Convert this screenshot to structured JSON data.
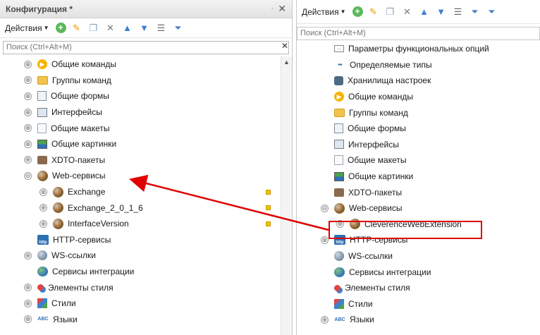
{
  "left": {
    "title": "Конфигурация *",
    "toolbar": {
      "actions_label": "Действия"
    },
    "search": {
      "placeholder": "Поиск (Ctrl+Alt+M)"
    },
    "items": [
      {
        "label": "Общие команды",
        "icon": "command-icon",
        "expander": "⊕"
      },
      {
        "label": "Группы команд",
        "icon": "folder-icon",
        "expander": "⊕"
      },
      {
        "label": "Общие формы",
        "icon": "form-icon",
        "expander": "⊕"
      },
      {
        "label": "Интерфейсы",
        "icon": "interface-icon",
        "expander": "⊕"
      },
      {
        "label": "Общие макеты",
        "icon": "layout-icon",
        "expander": "⊕"
      },
      {
        "label": "Общие картинки",
        "icon": "picture-icon",
        "expander": "⊕"
      },
      {
        "label": "XDTO-пакеты",
        "icon": "xdto-icon",
        "expander": "⊕"
      },
      {
        "label": "Web-сервисы",
        "icon": "web-service-icon",
        "expander": "⊖"
      },
      {
        "label": "Exchange",
        "icon": "web-service-icon",
        "expander": "⊕"
      },
      {
        "label": "Exchange_2_0_1_6",
        "icon": "web-service-icon",
        "expander": "⊕"
      },
      {
        "label": "InterfaceVersion",
        "icon": "web-service-icon",
        "expander": "⊕"
      },
      {
        "label": "HTTP-сервисы",
        "icon": "http-icon",
        "expander": ""
      },
      {
        "label": "WS-ссылки",
        "icon": "ws-link-icon",
        "expander": "⊕"
      },
      {
        "label": "Сервисы интеграции",
        "icon": "integration-icon",
        "expander": ""
      },
      {
        "label": "Элементы стиля",
        "icon": "style-element-icon",
        "expander": "⊕"
      },
      {
        "label": "Стили",
        "icon": "styles-icon",
        "expander": "⊕"
      },
      {
        "label": "Языки",
        "icon": "language-icon",
        "expander": "⊕"
      }
    ]
  },
  "right": {
    "toolbar": {
      "actions_label": "Действия"
    },
    "search": {
      "placeholder": "Поиск (Ctrl+Alt+M)"
    },
    "items": [
      {
        "label": "Параметры функциональных опций",
        "icon": "params-icon",
        "expander": ""
      },
      {
        "label": "Определяемые типы",
        "icon": "types-icon",
        "expander": ""
      },
      {
        "label": "Хранилища настроек",
        "icon": "storage-icon",
        "expander": ""
      },
      {
        "label": "Общие команды",
        "icon": "command-icon",
        "expander": ""
      },
      {
        "label": "Группы команд",
        "icon": "folder-icon",
        "expander": ""
      },
      {
        "label": "Общие формы",
        "icon": "form-icon",
        "expander": ""
      },
      {
        "label": "Интерфейсы",
        "icon": "interface-icon",
        "expander": ""
      },
      {
        "label": "Общие макеты",
        "icon": "layout-icon",
        "expander": ""
      },
      {
        "label": "Общие картинки",
        "icon": "picture-icon",
        "expander": ""
      },
      {
        "label": "XDTO-пакеты",
        "icon": "xdto-icon",
        "expander": ""
      },
      {
        "label": "Web-сервисы",
        "icon": "web-service-icon",
        "expander": "⊖"
      },
      {
        "label": "CleverenceWebExtension",
        "icon": "web-service-icon",
        "expander": "⊕"
      },
      {
        "label": "HTTP-сервисы",
        "icon": "http-icon",
        "expander": "⊕"
      },
      {
        "label": "WS-ссылки",
        "icon": "ws-link-icon",
        "expander": ""
      },
      {
        "label": "Сервисы интеграции",
        "icon": "integration-icon",
        "expander": ""
      },
      {
        "label": "Элементы стиля",
        "icon": "style-element-icon",
        "expander": ""
      },
      {
        "label": "Стили",
        "icon": "styles-icon",
        "expander": ""
      },
      {
        "label": "Языки",
        "icon": "language-icon",
        "expander": "⊕"
      }
    ]
  },
  "annotation": {
    "color": "#e00000"
  }
}
